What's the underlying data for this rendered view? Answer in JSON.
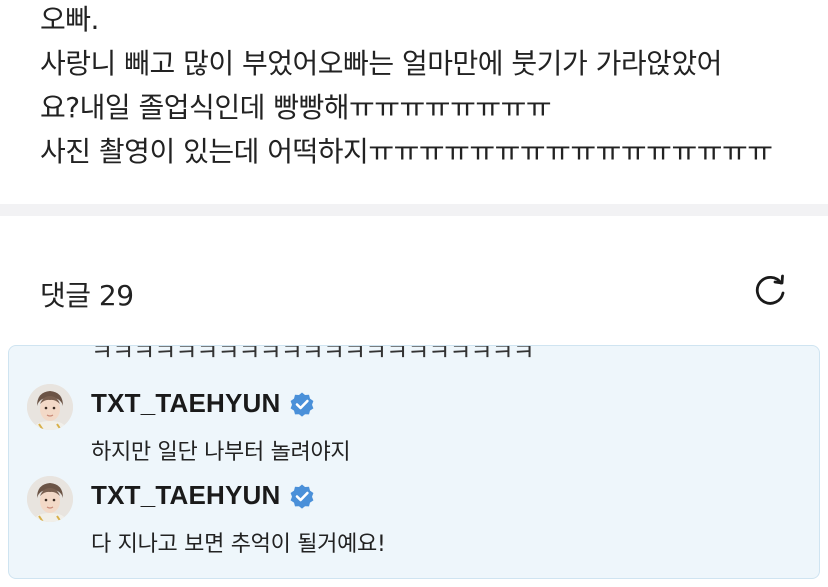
{
  "post": {
    "lines": [
      "오빠.",
      "사랑니 빼고 많이 부었어오빠는 얼마만에 붓기가 가라앉았어",
      "요?내일 졸업식인데 빵빵해ㅠㅠㅠㅠㅠㅠㅠㅠ",
      "사진 촬영이 있는데 어떡하지ㅠㅠㅠㅠㅠㅠㅠㅠㅠㅠㅠㅠㅠㅠㅠㅠ"
    ]
  },
  "comments": {
    "title": "댓글 29",
    "refresh_icon": "refresh-icon",
    "overflow_text": "ㅋㅋㅋㅋㅋㅋㅋㅋㅋㅋㅋㅋㅋㅋㅋㅋㅋㅋㅋㅋㅋ",
    "replies": [
      {
        "author": "TXT_TAEHYUN",
        "verified": true,
        "text": "하지만 일단 나부터 놀려야지"
      },
      {
        "author": "TXT_TAEHYUN",
        "verified": true,
        "text": "다 지나고 보면 추억이 될거예요!"
      }
    ]
  },
  "colors": {
    "highlight_background": "#eef6fb",
    "highlight_border": "#cfe4f1",
    "verified_badge": "#4a90d9",
    "divider": "#f2f2f4"
  }
}
